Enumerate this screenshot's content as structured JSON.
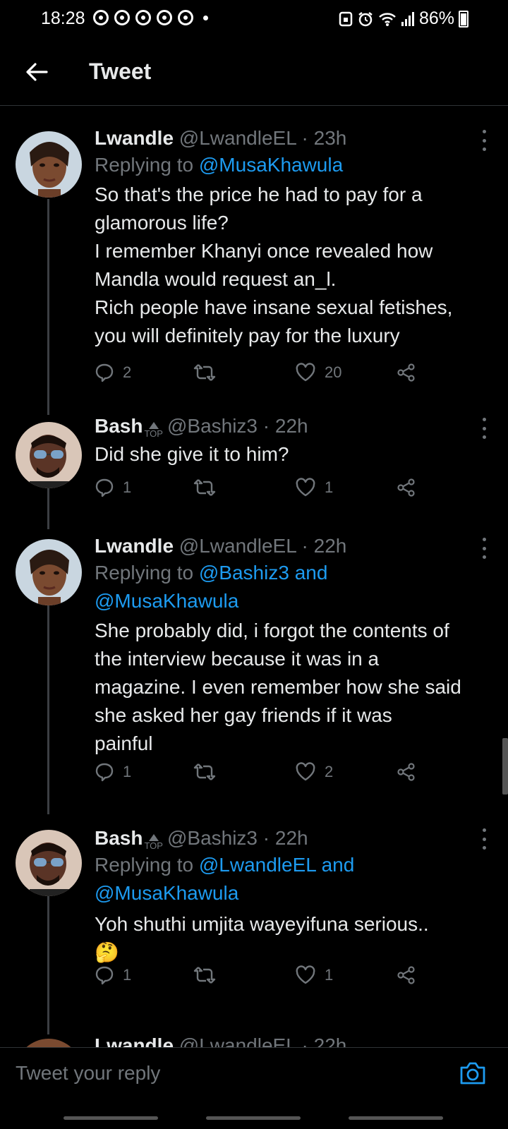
{
  "status_bar": {
    "time": "18:28",
    "battery": "86%"
  },
  "header": {
    "title": "Tweet"
  },
  "tweets": [
    {
      "name": "Lwandle",
      "handle": "@LwandleEL",
      "time": "· 23h",
      "replying_prefix": "Replying to ",
      "replying_mentions": "@MusaKhawula",
      "replying_mentions_2": "",
      "text_lines": [
        "So that's the price he had to pay for a",
        "glamorous life?",
        "I remember Khanyi once revealed how",
        "Mandla would request an_l.",
        "Rich people have insane sexual fetishes,",
        "you will definitely pay for the luxury"
      ],
      "replies": "2",
      "retweets": "",
      "likes": "20"
    },
    {
      "name": "Bash",
      "badge": "TOP",
      "handle": "@Bashiz3",
      "time": "· 22h",
      "text_lines": [
        "Did she give it to him?"
      ],
      "replies": "1",
      "retweets": "",
      "likes": "1"
    },
    {
      "name": "Lwandle",
      "handle": "@LwandleEL",
      "time": "· 22h",
      "replying_prefix": "Replying to ",
      "replying_mentions": "@Bashiz3 and",
      "replying_mentions_2": "@MusaKhawula",
      "text_lines": [
        "She probably did, i forgot the contents of",
        "the interview because it  was in a",
        "magazine. I even remember how she said",
        "she asked her gay friends if it was",
        "painful"
      ],
      "replies": "1",
      "retweets": "",
      "likes": "2"
    },
    {
      "name": "Bash",
      "badge": "TOP",
      "handle": "@Bashiz3",
      "time": "· 22h",
      "replying_prefix": "Replying to ",
      "replying_mentions": "@LwandleEL and",
      "replying_mentions_2": "@MusaKhawula",
      "text_lines": [
        "Yoh shuthi umjita wayeyifuna serious.."
      ],
      "emoji": "🤔",
      "replies": "1",
      "retweets": "",
      "likes": "1"
    }
  ],
  "partial_tweet": {
    "name": "Lwandle",
    "handle": "@LwandleEL",
    "time": "· 22h"
  },
  "composer": {
    "placeholder": "Tweet your reply"
  },
  "icons": {
    "back": "arrow-left-icon",
    "reply": "reply-icon",
    "retweet": "retweet-icon",
    "like": "heart-icon",
    "share": "share-icon",
    "more": "more-vertical-icon",
    "camera": "camera-icon"
  },
  "colors": {
    "background": "#000000",
    "link": "#1d9bf0",
    "muted": "#71767b",
    "text": "#e7e9ea"
  }
}
